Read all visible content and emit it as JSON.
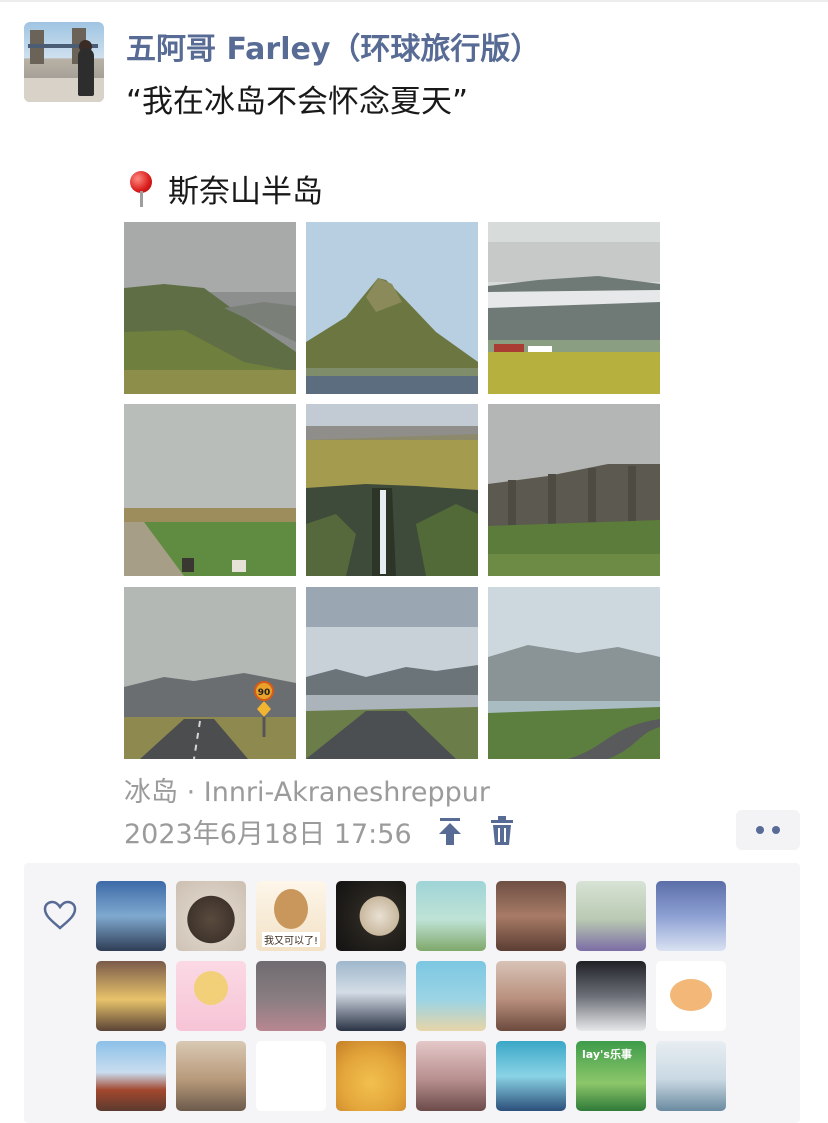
{
  "post": {
    "username": "五阿哥 Farley（环球旅行版）",
    "text": "“我在冰岛不会怀念夏天”",
    "location_text": "斯奈山半岛",
    "place": "冰岛 · Innri-Akraneshreppur",
    "timestamp": "2023年6月18日 17:56"
  },
  "photos": [
    {
      "name": "photo-green-slope"
    },
    {
      "name": "photo-kirkjufell"
    },
    {
      "name": "photo-farmhouse-meadow"
    },
    {
      "name": "photo-flat-field-road"
    },
    {
      "name": "photo-waterfall-canyon"
    },
    {
      "name": "photo-basalt-cliffs"
    },
    {
      "name": "photo-road-speed-sign"
    },
    {
      "name": "photo-fjord-road"
    },
    {
      "name": "photo-curved-road-sea"
    }
  ],
  "speed_sign": "90",
  "likes": {
    "avatars": [
      {
        "name": "like-avatar-1"
      },
      {
        "name": "like-avatar-2"
      },
      {
        "name": "like-avatar-3",
        "caption": "我又可以了!"
      },
      {
        "name": "like-avatar-4"
      },
      {
        "name": "like-avatar-5"
      },
      {
        "name": "like-avatar-6"
      },
      {
        "name": "like-avatar-7"
      },
      {
        "name": "like-avatar-8"
      },
      {
        "name": "like-avatar-9"
      },
      {
        "name": "like-avatar-10"
      },
      {
        "name": "like-avatar-11"
      },
      {
        "name": "like-avatar-12"
      },
      {
        "name": "like-avatar-13"
      },
      {
        "name": "like-avatar-14"
      },
      {
        "name": "like-avatar-15"
      },
      {
        "name": "like-avatar-16"
      },
      {
        "name": "like-avatar-17"
      },
      {
        "name": "like-avatar-18"
      },
      {
        "name": "like-avatar-19"
      },
      {
        "name": "like-avatar-20"
      },
      {
        "name": "like-avatar-21"
      },
      {
        "name": "like-avatar-22"
      },
      {
        "name": "like-avatar-23",
        "caption2": "lay's乐事"
      },
      {
        "name": "like-avatar-24"
      }
    ]
  },
  "colors": {
    "name_blue": "#576b95",
    "meta_gray": "#9b9b9b",
    "text_black": "#191919",
    "likes_bg": "#f5f5f7"
  },
  "icons": [
    "location-pin-icon",
    "pin-to-top-icon",
    "trash-icon",
    "more-dots-icon",
    "heart-icon"
  ]
}
